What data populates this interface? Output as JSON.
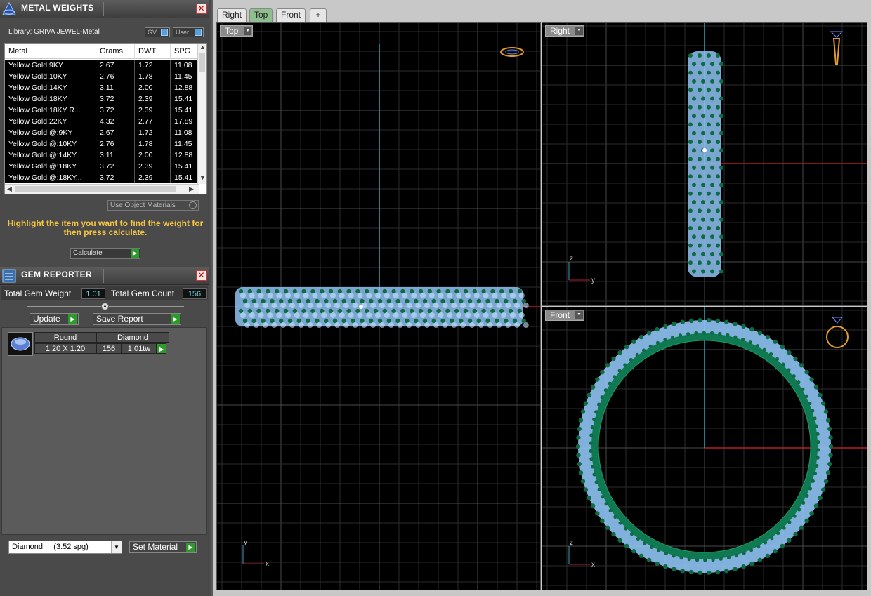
{
  "metal_panel": {
    "title": "METAL WEIGHTS",
    "library_label": "Library: GRIVA JEWEL-Metal",
    "gv_label": "GV",
    "user_label": "User",
    "columns": [
      "Metal",
      "Grams",
      "DWT",
      "SPG"
    ],
    "rows": [
      [
        "Yellow Gold:9KY",
        "2.67",
        "1.72",
        "11.08"
      ],
      [
        "Yellow Gold:10KY",
        "2.76",
        "1.78",
        "11.45"
      ],
      [
        "Yellow Gold:14KY",
        "3.11",
        "2.00",
        "12.88"
      ],
      [
        "Yellow Gold:18KY",
        "3.72",
        "2.39",
        "15.41"
      ],
      [
        "Yellow Gold:18KY R...",
        "3.72",
        "2.39",
        "15.41"
      ],
      [
        "Yellow Gold:22KY",
        "4.32",
        "2.77",
        "17.89"
      ],
      [
        "Yellow Gold @:9KY",
        "2.67",
        "1.72",
        "11.08"
      ],
      [
        "Yellow Gold @:10KY",
        "2.76",
        "1.78",
        "11.45"
      ],
      [
        "Yellow Gold @:14KY",
        "3.11",
        "2.00",
        "12.88"
      ],
      [
        "Yellow Gold @:18KY",
        "3.72",
        "2.39",
        "15.41"
      ],
      [
        "Yellow Gold @:18KY...",
        "3.72",
        "2.39",
        "15.41"
      ]
    ],
    "use_object_materials": "Use Object Materials",
    "hint": "Highlight the item you want to find the weight for then press calculate.",
    "calculate": "Calculate"
  },
  "gem_panel": {
    "title": "GEM REPORTER",
    "total_weight_label": "Total Gem Weight",
    "total_weight_value": "1.01",
    "total_count_label": "Total Gem Count",
    "total_count_value": "156",
    "update": "Update",
    "save_report": "Save Report",
    "gem": {
      "shape": "Round",
      "type": "Diamond",
      "size": "1.20 X 1.20",
      "count": "156",
      "weight": "1.01tw"
    },
    "material_select": "Diamond     (3.52 spg)",
    "set_material": "Set Material"
  },
  "tabs": [
    "Right",
    "Top",
    "Front",
    "+"
  ],
  "active_tab": "Top",
  "viewports": {
    "top": {
      "label": "Top",
      "axis_a": "y",
      "axis_b": "x"
    },
    "right": {
      "label": "Right",
      "axis_a": "z",
      "axis_b": "y"
    },
    "front": {
      "label": "Front",
      "axis_a": "z",
      "axis_b": "x"
    }
  },
  "colors": {
    "gem_blue": "#8fc3f5",
    "prong_green": "#0f6b44",
    "ring_green": "#0f7a52",
    "axis_cyan": "#3aa0b8",
    "axis_red": "#b52020",
    "hint_yellow": "#f5c542"
  }
}
